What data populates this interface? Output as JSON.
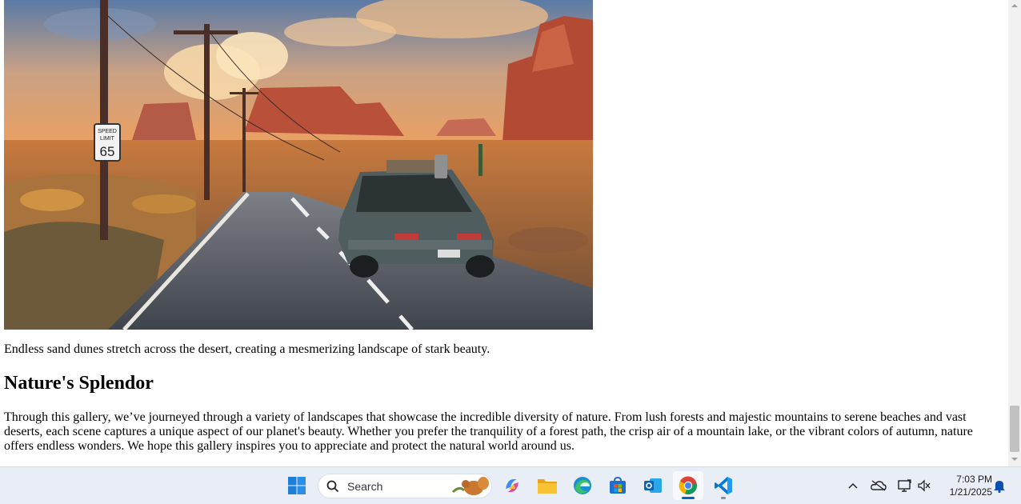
{
  "page": {
    "caption": "Endless sand dunes stretch across the desert, creating a mesmerizing landscape of stark beauty.",
    "section_title": "Nature's Splendor",
    "body": "Through this gallery, we’ve journeyed through a variety of landscapes that showcase the incredible diversity of nature. From lush forests and majestic mountains to serene beaches and vast deserts, each scene captures a unique aspect of our planet's beauty. Whether you prefer the tranquility of a forest path, the crisp air of a mountain lake, or the vibrant colors of autumn, nature offers endless wonders. We hope this gallery inspires you to appreciate and protect the natural world around us."
  },
  "hero_image": {
    "sign_speed": "SPEED",
    "sign_limit": "LIMIT",
    "sign_value": "65",
    "colors": {
      "sky_top": "#5f7ea8",
      "sky_low": "#f2a25e",
      "rock": "#b8503a",
      "road": "#4a4f57",
      "car": "#4f5d5f"
    }
  },
  "taskbar": {
    "search_placeholder": "Search",
    "apps": [
      "start-icon",
      "copilot-icon",
      "file-explorer-icon",
      "edge-icon",
      "microsoft-store-icon",
      "outlook-icon",
      "chrome-icon",
      "vscode-icon"
    ],
    "active_app": "chrome-icon",
    "clock_time": "7:03 PM",
    "clock_date": "1/21/2025",
    "tray": [
      "chevron-up-icon",
      "onedrive-icon",
      "network-icon",
      "volume-icon",
      "notification-bell-icon"
    ]
  },
  "colors": {
    "taskbar_bg": "#e9eef6",
    "accent": "#0067c0"
  }
}
